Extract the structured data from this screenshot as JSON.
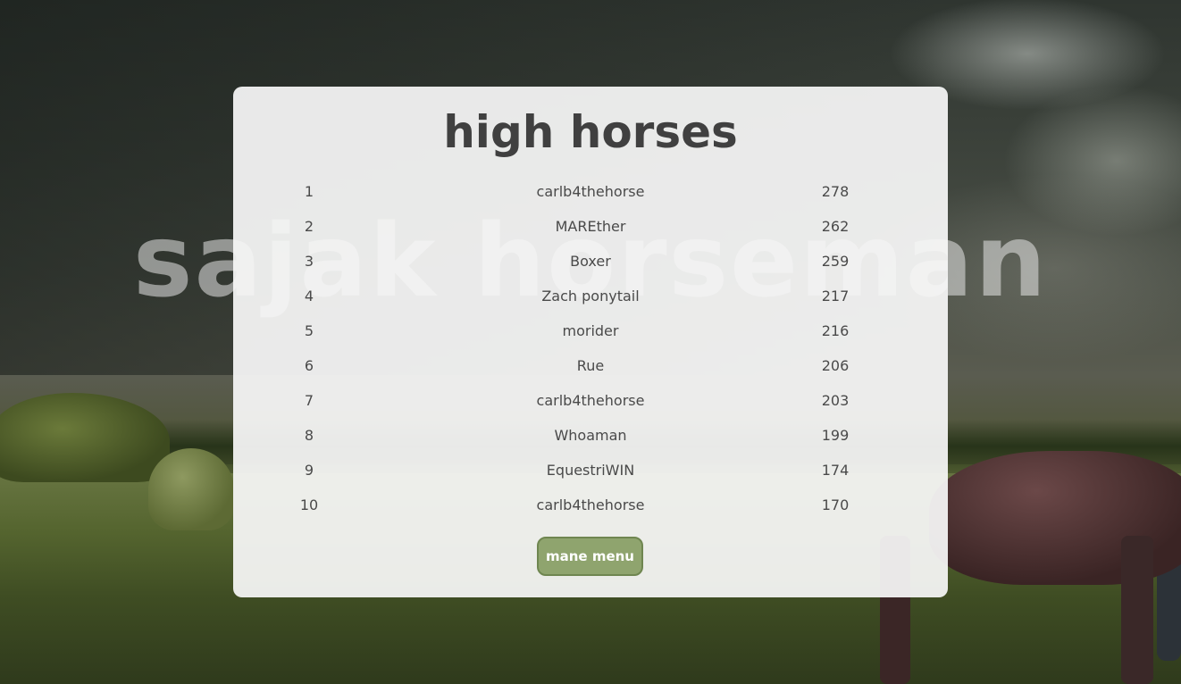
{
  "background": {
    "title": "sajak horseman"
  },
  "leaderboard": {
    "title": "high horses",
    "rows": [
      {
        "rank": "1",
        "name": "carlb4thehorse",
        "score": "278"
      },
      {
        "rank": "2",
        "name": "MAREther",
        "score": "262"
      },
      {
        "rank": "3",
        "name": "Boxer",
        "score": "259"
      },
      {
        "rank": "4",
        "name": "Zach ponytail",
        "score": "217"
      },
      {
        "rank": "5",
        "name": "morider",
        "score": "216"
      },
      {
        "rank": "6",
        "name": "Rue",
        "score": "206"
      },
      {
        "rank": "7",
        "name": "carlb4thehorse",
        "score": "203"
      },
      {
        "rank": "8",
        "name": "Whoaman",
        "score": "199"
      },
      {
        "rank": "9",
        "name": "EquestriWIN",
        "score": "174"
      },
      {
        "rank": "10",
        "name": "carlb4thehorse",
        "score": "170"
      }
    ],
    "menu_button_label": "mane menu"
  },
  "colors": {
    "button_bg": "#8fa46e",
    "button_border": "#6f8650",
    "panel_bg": "#f8f7f7",
    "title_text": "#404040"
  }
}
